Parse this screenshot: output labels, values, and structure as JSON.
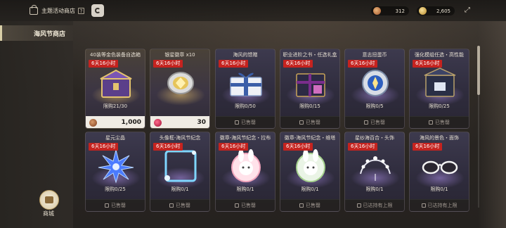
{
  "header": {
    "title": "主题活动商店",
    "help_label": "?",
    "currencies": [
      {
        "name": "copper-coin",
        "value": "312"
      },
      {
        "name": "gold-coin",
        "value": "2,605"
      }
    ],
    "expand_icon": "⤢"
  },
  "sidebar": {
    "items": [
      {
        "label": "海风节商店"
      }
    ],
    "mall_label": "商城"
  },
  "colors": {
    "tag_red": "#c5231f",
    "price_bg": "#f0ece4"
  },
  "items": [
    {
      "name": "40装等金色装备自选箱",
      "tag": "6天16小时",
      "limit": "限购21/30",
      "bottom": "1,000",
      "price": true,
      "price_icon": "copper",
      "art": "chest"
    },
    {
      "name": "银星徽章 x10",
      "tag": "6天16小时",
      "limit": "",
      "bottom": "30",
      "price": true,
      "price_icon": "ruby",
      "art": "badge"
    },
    {
      "name": "海风的馈赠",
      "tag": "6天16小时",
      "limit": "限购0/50",
      "bottom": "已售罄",
      "price": false,
      "art": "gift"
    },
    {
      "name": "职业进阶之书・任选礼盒",
      "tag": "6天16小时",
      "limit": "限购0/15",
      "bottom": "已售罄",
      "price": false,
      "art": "box"
    },
    {
      "name": "意志扭蛋币",
      "tag": "6天16小时",
      "limit": "限购0/5",
      "bottom": "已售罄",
      "price": false,
      "art": "coin"
    },
    {
      "name": "强化模组任选・高性能",
      "tag": "6天16小时",
      "limit": "限购0/25",
      "bottom": "已售罄",
      "price": false,
      "art": "module"
    },
    {
      "name": "星元尘晶",
      "tag": "6天16小时",
      "limit": "限购0/25",
      "bottom": "已售罄",
      "price": false,
      "art": "crystal"
    },
    {
      "name": "头像框-海风节纪念",
      "tag": "6天16小时",
      "limit": "限购0/1",
      "bottom": "已售罄",
      "price": false,
      "art": "frame"
    },
    {
      "name": "徽章-海风节纪念・拉布",
      "tag": "6天16小时",
      "limit": "限购0/1",
      "bottom": "已售罄",
      "price": false,
      "art": "bunny"
    },
    {
      "name": "徽章-海风节纪念・维塔",
      "tag": "6天16小时",
      "limit": "限购0/1",
      "bottom": "已售罄",
      "price": false,
      "art": "bunny2"
    },
    {
      "name": "星纱海百合・头饰",
      "tag": "6天16小时",
      "limit": "限购0/1",
      "bottom": "已达持有上限",
      "price": false,
      "art": "tiara"
    },
    {
      "name": "海风的景色・面饰",
      "tag": "6天16小时",
      "limit": "限购0/1",
      "bottom": "已达持有上限",
      "price": false,
      "art": "glasses"
    }
  ]
}
